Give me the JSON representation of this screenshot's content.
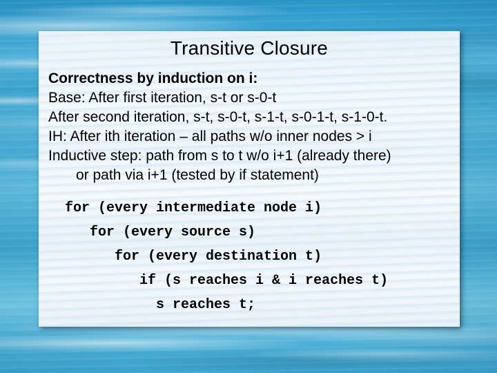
{
  "slide": {
    "title": "Transitive Closure",
    "background_color": "#2aa0cf",
    "panel_color": "#eef5fa",
    "text_color": "#000000"
  },
  "body": {
    "lines": [
      {
        "text": "Correctness by induction on i:",
        "bold": true,
        "indent": false
      },
      {
        "text": "Base: After first iteration, s-t or s-0-t",
        "bold": false,
        "indent": false
      },
      {
        "text": "After second iteration, s-t, s-0-t, s-1-t, s-0-1-t, s-1-0-t.",
        "bold": false,
        "indent": false
      },
      {
        "text": "IH: After ith iteration – all paths w/o inner nodes > i",
        "bold": false,
        "indent": false
      },
      {
        "text": "Inductive step: path from s to t w/o i+1 (already there)",
        "bold": false,
        "indent": false
      },
      {
        "text": "or path via i+1 (tested by if statement)",
        "bold": false,
        "indent": true
      }
    ]
  },
  "code": {
    "lines": [
      "  for (every intermediate node i)",
      "     for (every source s)",
      "        for (every destination t)",
      "           if (s reaches i & i reaches t)",
      "             s reaches t;"
    ]
  }
}
